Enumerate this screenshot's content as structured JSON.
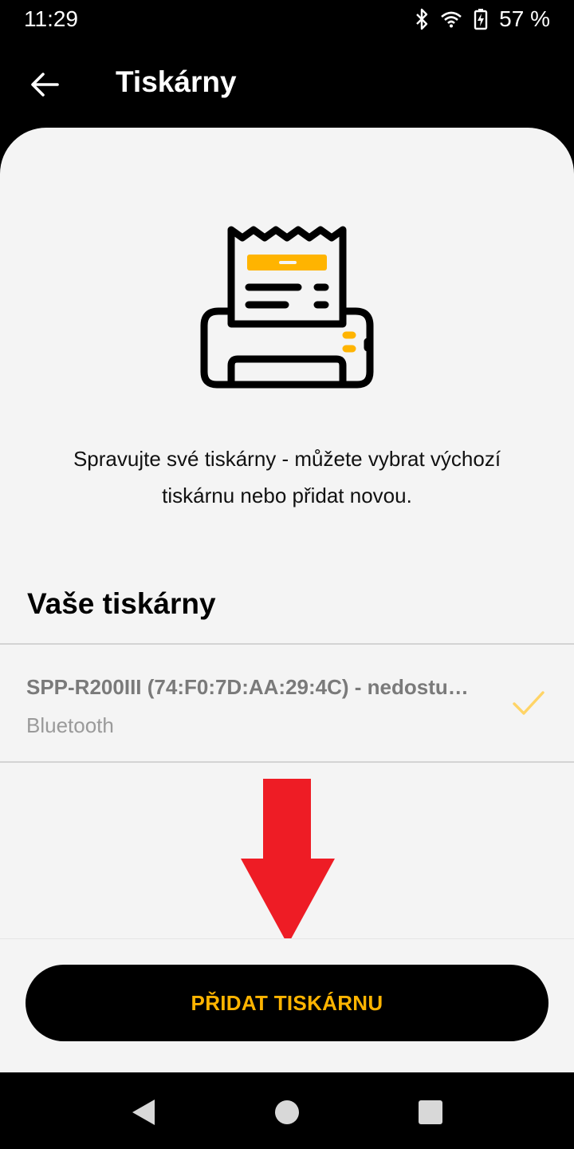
{
  "status": {
    "time": "11:29",
    "battery": "57 %"
  },
  "header": {
    "title": "Tiskárny"
  },
  "main": {
    "description_line1": "Spravujte své tiskárny - můžete vybrat výchozí",
    "description_line2": "tiskárnu nebo přidat novou.",
    "section_title": "Vaše tiskárny",
    "printers": [
      {
        "name": "SPP-R200III (74:F0:7D:AA:29:4C) - nedostu…",
        "type": "Bluetooth",
        "selected": true
      }
    ],
    "add_button_label": "PŘIDAT TISKÁRNU"
  },
  "colors": {
    "accent": "#ffb400",
    "annotation_arrow": "#ee1c25"
  },
  "icons": [
    "back-arrow-icon",
    "printer-receipt-icon",
    "check-icon",
    "bluetooth-icon",
    "wifi-icon",
    "battery-icon",
    "nav-back-icon",
    "nav-home-icon",
    "nav-recents-icon"
  ]
}
